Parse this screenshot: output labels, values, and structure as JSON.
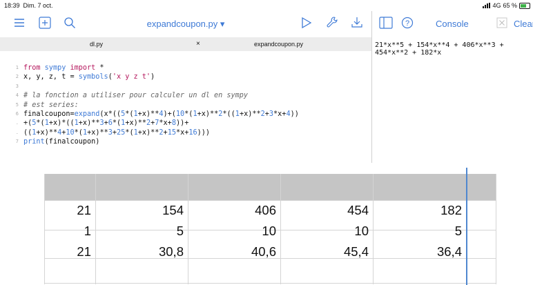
{
  "status": {
    "time": "18:39",
    "date": "Dim. 7 oct.",
    "network": "4G",
    "battery": "65 %"
  },
  "editor": {
    "title": "expandcoupon.py ▾",
    "tabs": [
      "dl.py",
      "expandcoupon.py"
    ],
    "close_glyph": "×",
    "lines": [
      {
        "n": "1",
        "parts": [
          [
            "kw",
            "from "
          ],
          [
            "fn",
            "sympy"
          ],
          [
            "kw",
            " import "
          ],
          [
            "",
            "*"
          ]
        ]
      },
      {
        "n": "2",
        "parts": [
          [
            "",
            "x, y, z, t = "
          ],
          [
            "fn",
            "symbols"
          ],
          [
            "",
            "("
          ],
          [
            "str",
            "'x y z t'"
          ],
          [
            "",
            ")"
          ]
        ]
      },
      {
        "n": "3",
        "parts": []
      },
      {
        "n": "4",
        "parts": [
          [
            "cm",
            "# la fonction a utiliser pour calculer un dl en sympy"
          ]
        ]
      },
      {
        "n": "5",
        "parts": [
          [
            "cm",
            "# est series:"
          ]
        ]
      },
      {
        "n": "6",
        "parts": [
          [
            "",
            "finalcoupon="
          ],
          [
            "fn",
            "expand"
          ],
          [
            "",
            "(x*(("
          ],
          [
            "num",
            "5"
          ],
          [
            "",
            "*("
          ],
          [
            "num",
            "1"
          ],
          [
            "",
            "+x)**"
          ],
          [
            "num",
            "4"
          ],
          [
            "",
            ")+("
          ],
          [
            "num",
            "10"
          ],
          [
            "",
            "*("
          ],
          [
            "num",
            "1"
          ],
          [
            "",
            "+x)**"
          ],
          [
            "num",
            "2"
          ],
          [
            "",
            "*(("
          ],
          [
            "num",
            "1"
          ],
          [
            "",
            "+x)**"
          ],
          [
            "num",
            "2"
          ],
          [
            "",
            "+"
          ],
          [
            "num",
            "3"
          ],
          [
            "",
            "*x+"
          ],
          [
            "num",
            "4"
          ],
          [
            "",
            "))"
          ]
        ]
      },
      {
        "n": ".",
        "parts": [
          [
            "",
            "+("
          ],
          [
            "num",
            "5"
          ],
          [
            "",
            "*("
          ],
          [
            "num",
            "1"
          ],
          [
            "",
            "+x)*(("
          ],
          [
            "num",
            "1"
          ],
          [
            "",
            "+x)**"
          ],
          [
            "num",
            "3"
          ],
          [
            "",
            "+"
          ],
          [
            "num",
            "6"
          ],
          [
            "",
            "*("
          ],
          [
            "num",
            "1"
          ],
          [
            "",
            "+x)**"
          ],
          [
            "num",
            "2"
          ],
          [
            "",
            "+"
          ],
          [
            "num",
            "7"
          ],
          [
            "",
            "*x+"
          ],
          [
            "num",
            "8"
          ],
          [
            "",
            "))+"
          ]
        ]
      },
      {
        "n": ".",
        "parts": [
          [
            "",
            "(("
          ],
          [
            "num",
            "1"
          ],
          [
            "",
            "+x)**"
          ],
          [
            "num",
            "4"
          ],
          [
            "",
            "+"
          ],
          [
            "num",
            "10"
          ],
          [
            "",
            "*("
          ],
          [
            "num",
            "1"
          ],
          [
            "",
            "+x)**"
          ],
          [
            "num",
            "3"
          ],
          [
            "",
            "+"
          ],
          [
            "num",
            "25"
          ],
          [
            "",
            "*("
          ],
          [
            "num",
            "1"
          ],
          [
            "",
            "+x)**"
          ],
          [
            "num",
            "2"
          ],
          [
            "",
            "+"
          ],
          [
            "num",
            "15"
          ],
          [
            "",
            "*x+"
          ],
          [
            "num",
            "16"
          ],
          [
            "",
            ")))"
          ]
        ]
      },
      {
        "n": "7",
        "parts": [
          [
            "fn",
            "print"
          ],
          [
            "",
            "(finalcoupon)"
          ]
        ]
      }
    ]
  },
  "console": {
    "title": "Console",
    "clear_label": "Clear",
    "output": "21*x**5 + 154*x**4 + 406*x**3 + 454*x**2 + 182*x"
  },
  "table": {
    "rows": [
      [
        "21",
        "154",
        "406",
        "454",
        "182"
      ],
      [
        "1",
        "5",
        "10",
        "10",
        "5"
      ],
      [
        "21",
        "30,8",
        "40,6",
        "45,4",
        "36,4"
      ]
    ]
  },
  "icons": {
    "menu": "hamburger-icon",
    "add": "plus-square-icon",
    "search": "search-icon",
    "run": "play-icon",
    "tools": "wrench-icon",
    "share": "share-icon",
    "layout": "split-view-icon",
    "help": "help-icon",
    "clear": "clear-x-icon"
  },
  "colors": {
    "accent": "#3e7ad6",
    "keyword": "#b5175d",
    "header_gray": "#c5c5c5"
  }
}
